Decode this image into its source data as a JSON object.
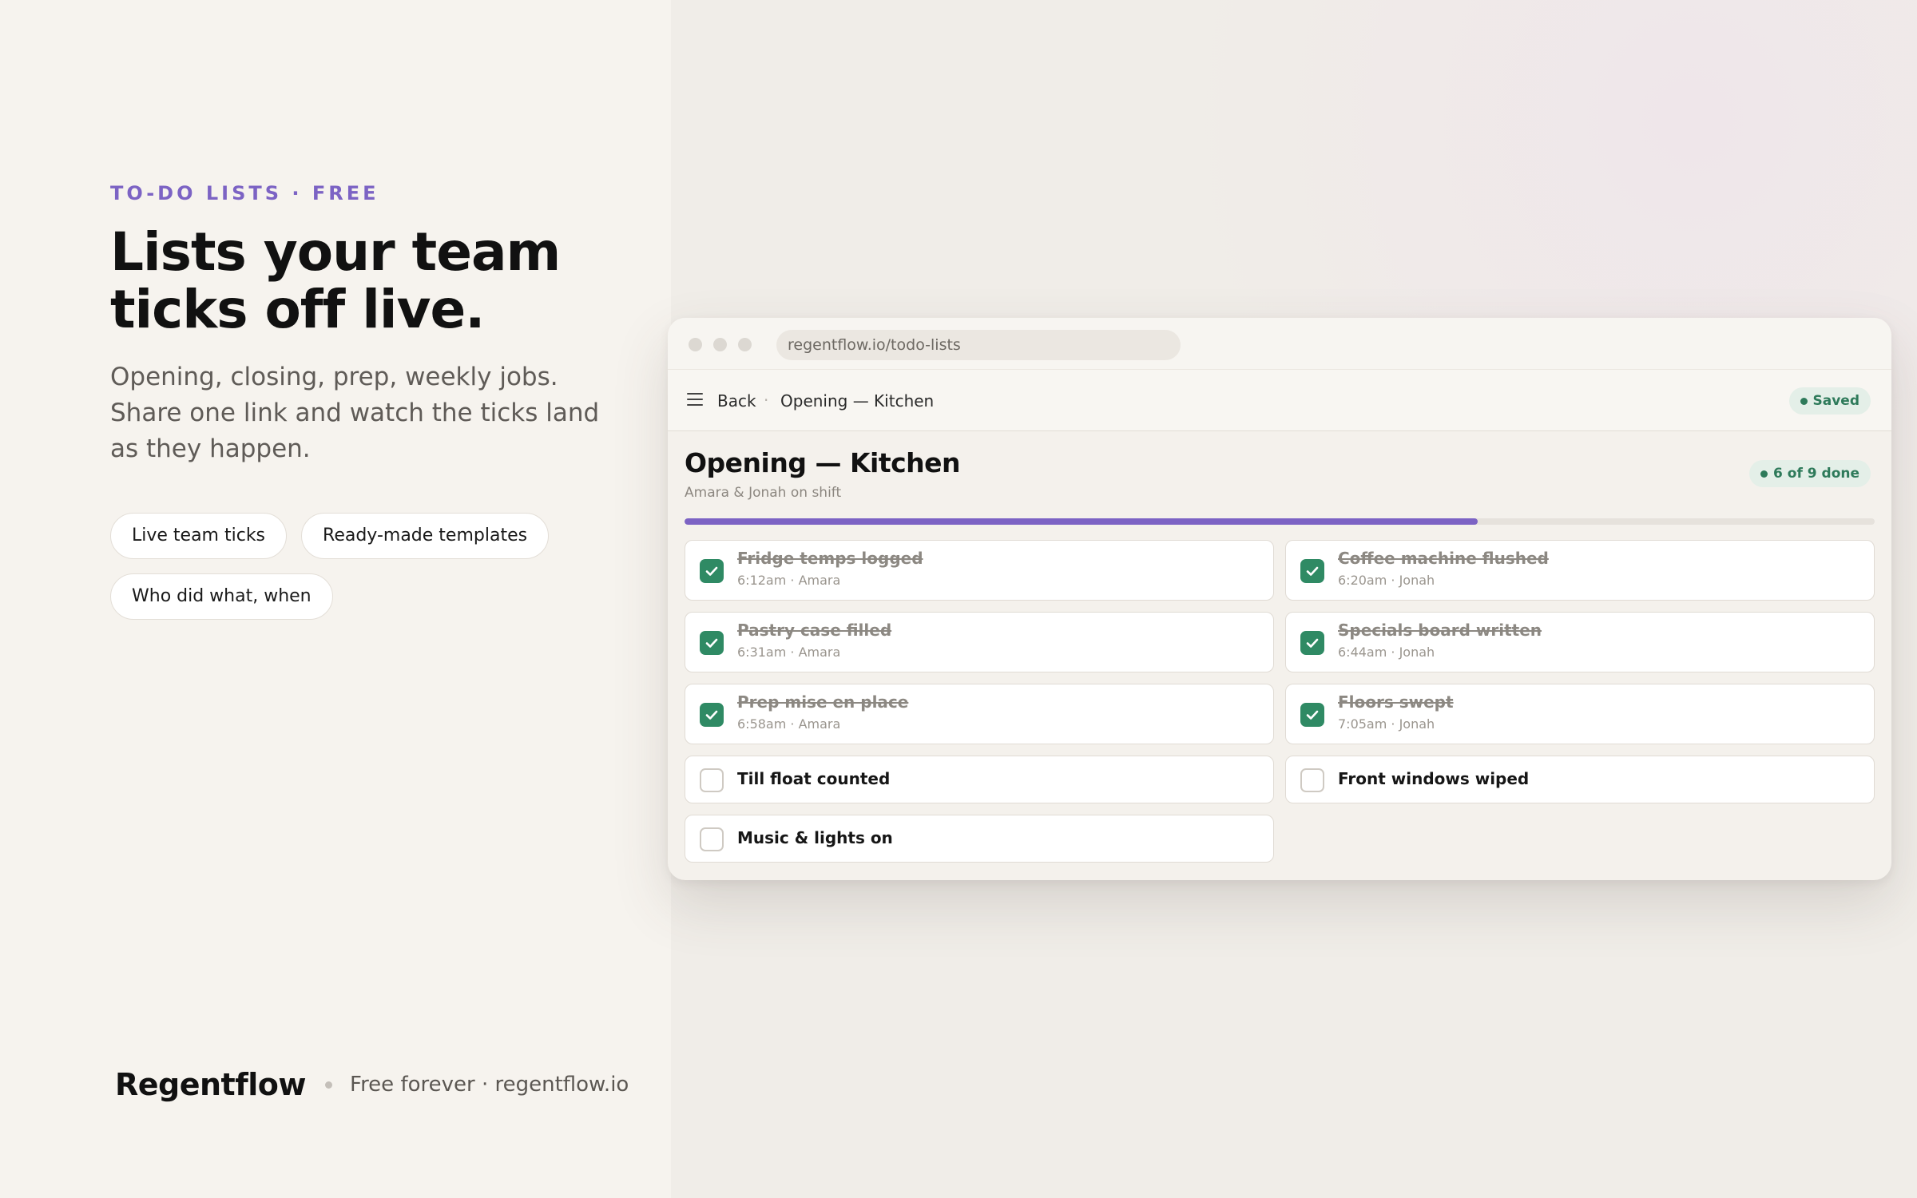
{
  "hero": {
    "eyebrow": "TO-DO LISTS · FREE",
    "headline": "Lists your team ticks off live.",
    "subcopy": "Opening, closing, prep, weekly jobs. Share one link and watch the ticks land as they happen.",
    "chips": [
      "Live team ticks",
      "Ready-made templates",
      "Who did what, when"
    ]
  },
  "footer": {
    "brand": "Regentflow",
    "tagline": "Free forever · regentflow.io"
  },
  "browser": {
    "url": "regentflow.io/todo-lists"
  },
  "app": {
    "nav": {
      "back_label": "Back",
      "separator": "·",
      "breadcrumb": "Opening — Kitchen",
      "status": "Saved"
    },
    "list": {
      "title": "Opening — Kitchen",
      "subtitle": "Amara & Jonah on shift",
      "progress_label": "6 of 9 done",
      "progress_fraction": 0.6667,
      "tasks": [
        {
          "label": "Fridge temps logged",
          "meta": "6:12am · Amara",
          "done": true
        },
        {
          "label": "Coffee machine flushed",
          "meta": "6:20am · Jonah",
          "done": true
        },
        {
          "label": "Pastry case filled",
          "meta": "6:31am · Amara",
          "done": true
        },
        {
          "label": "Specials board written",
          "meta": "6:44am · Jonah",
          "done": true
        },
        {
          "label": "Prep mise en place",
          "meta": "6:58am · Amara",
          "done": true
        },
        {
          "label": "Floors swept",
          "meta": "7:05am · Jonah",
          "done": true
        },
        {
          "label": "Till float counted",
          "meta": "",
          "done": false
        },
        {
          "label": "Front windows wiped",
          "meta": "",
          "done": false
        },
        {
          "label": "Music & lights on",
          "meta": "",
          "done": false
        }
      ]
    }
  },
  "colors": {
    "accent": "#7c63c4",
    "success": "#2f8a64",
    "background": "#f6f3ee"
  }
}
